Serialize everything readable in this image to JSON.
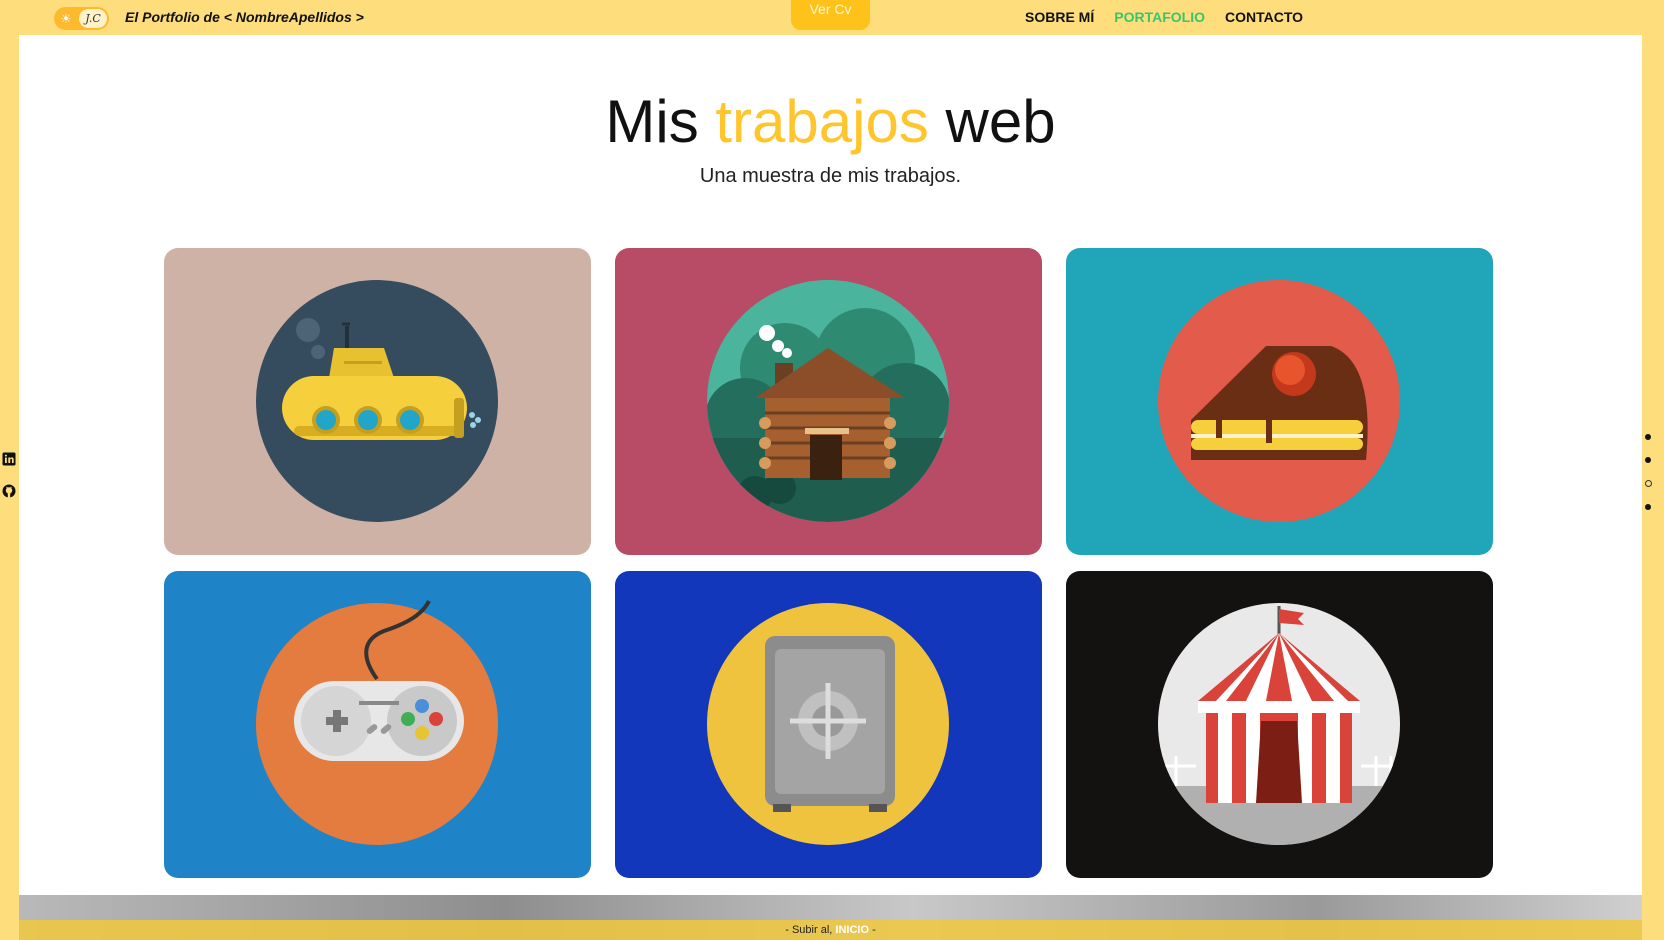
{
  "header": {
    "toggle_sun": "☀",
    "toggle_monogram": "J.C",
    "brand": "El Portfolio de < NombreApellidos >",
    "cv_button": "Ver Cv",
    "nav": [
      {
        "label": "SOBRE MÍ",
        "active": false
      },
      {
        "label": "PORTAFOLIO",
        "active": true
      },
      {
        "label": "CONTACTO",
        "active": false
      }
    ]
  },
  "main": {
    "title_part1": "Mis",
    "title_highlight": "trabajos",
    "title_part2": "web",
    "subtitle": "Una muestra de mis trabajos."
  },
  "projects": [
    {
      "icon": "submarine",
      "bg": "#cdb2a5",
      "circle": "#354b5e"
    },
    {
      "icon": "log-cabin",
      "bg": "#b84c66",
      "circle": "#4ab59c"
    },
    {
      "icon": "cake-slice",
      "bg": "#21a5b8",
      "circle": "#e35b4a"
    },
    {
      "icon": "game-controller",
      "bg": "#1e84c7",
      "circle": "#e47b3f"
    },
    {
      "icon": "safe",
      "bg": "#1237bb",
      "circle": "#f0c33f"
    },
    {
      "icon": "circus-tent",
      "bg": "#141111",
      "circle": "#e9e9e9"
    }
  ],
  "footer": {
    "text_prefix": "-   Subir al,",
    "link": "INICIO",
    "text_suffix": "-"
  },
  "side": {
    "social": [
      "linkedin-icon",
      "github-icon"
    ],
    "page_dots": 4
  },
  "colors": {
    "accent": "#fec52c",
    "active_nav": "#39c56a",
    "frame": "#fedd7c"
  }
}
